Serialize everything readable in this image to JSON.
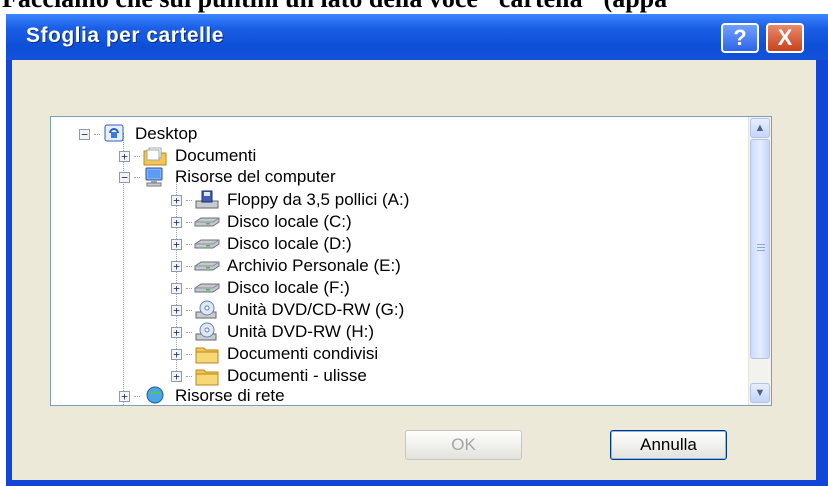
{
  "document_heading": "Facciamo che sui puntini un lato della voce \"cartella\" (appa",
  "dialog": {
    "title": "Sfoglia per cartelle",
    "help_label": "?",
    "close_label": "X"
  },
  "tree": {
    "items": [
      {
        "label": "Desktop",
        "icon": "desktop-icon",
        "expander": "−"
      },
      {
        "label": "Documenti",
        "icon": "documents-folder-icon",
        "expander": "+"
      },
      {
        "label": "Risorse del computer",
        "icon": "my-computer-icon",
        "expander": "−"
      },
      {
        "label": "Floppy da 3,5 pollici (A:)",
        "icon": "floppy-drive-icon",
        "expander": "+"
      },
      {
        "label": "Disco locale (C:)",
        "icon": "hard-disk-icon",
        "expander": "+"
      },
      {
        "label": "Disco locale (D:)",
        "icon": "hard-disk-icon",
        "expander": "+"
      },
      {
        "label": "Archivio Personale (E:)",
        "icon": "hard-disk-icon",
        "expander": "+"
      },
      {
        "label": "Disco locale (F:)",
        "icon": "hard-disk-icon",
        "expander": "+"
      },
      {
        "label": "Unità DVD/CD-RW (G:)",
        "icon": "dvd-drive-icon",
        "expander": "+"
      },
      {
        "label": "Unità DVD-RW (H:)",
        "icon": "dvd-drive-icon",
        "expander": "+"
      },
      {
        "label": "Documenti condivisi",
        "icon": "folder-icon",
        "expander": "+"
      },
      {
        "label": "Documenti - ulisse",
        "icon": "folder-icon",
        "expander": "+"
      },
      {
        "label": "Risorse di rete",
        "icon": "network-icon",
        "expander": "+"
      }
    ]
  },
  "buttons": {
    "ok": "OK",
    "cancel": "Annulla"
  },
  "colors": {
    "titlebar": "#0e4fd8",
    "dialog_bg": "#ece9d8",
    "folder": "#f3c552"
  }
}
